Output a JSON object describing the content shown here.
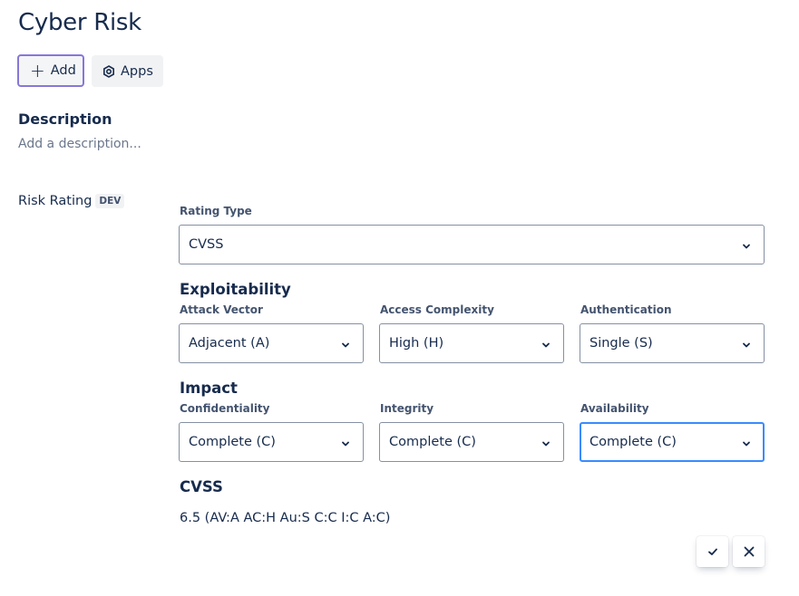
{
  "page": {
    "title": "Cyber Risk",
    "buttons": {
      "add_label": "Add",
      "apps_label": "Apps"
    }
  },
  "description": {
    "heading": "Description",
    "placeholder": "Add a description..."
  },
  "risk_rating": {
    "label": "Risk Rating",
    "badge": "DEV",
    "rating_type": {
      "label": "Rating Type",
      "value": "CVSS"
    },
    "exploitability": {
      "heading": "Exploitability",
      "fields": [
        {
          "label": "Attack Vector",
          "value": "Adjacent (A)"
        },
        {
          "label": "Access Complexity",
          "value": "High (H)"
        },
        {
          "label": "Authentication",
          "value": "Single (S)"
        }
      ]
    },
    "impact": {
      "heading": "Impact",
      "fields": [
        {
          "label": "Confidentiality",
          "value": "Complete (C)"
        },
        {
          "label": "Integrity",
          "value": "Complete (C)"
        },
        {
          "label": "Availability",
          "value": "Complete (C)"
        }
      ]
    },
    "cvss": {
      "heading": "CVSS",
      "score_text": "6.5 (AV:A AC:H Au:S C:C I:C A:C)"
    }
  },
  "icons": {
    "add": "plus-icon",
    "apps": "apps-icon",
    "dropdown": "chevron-down-icon",
    "confirm": "check-icon",
    "cancel": "close-icon"
  },
  "colors": {
    "text": "#172b4d",
    "focus_border": "#388bff",
    "add_button_border": "#8777d9"
  }
}
